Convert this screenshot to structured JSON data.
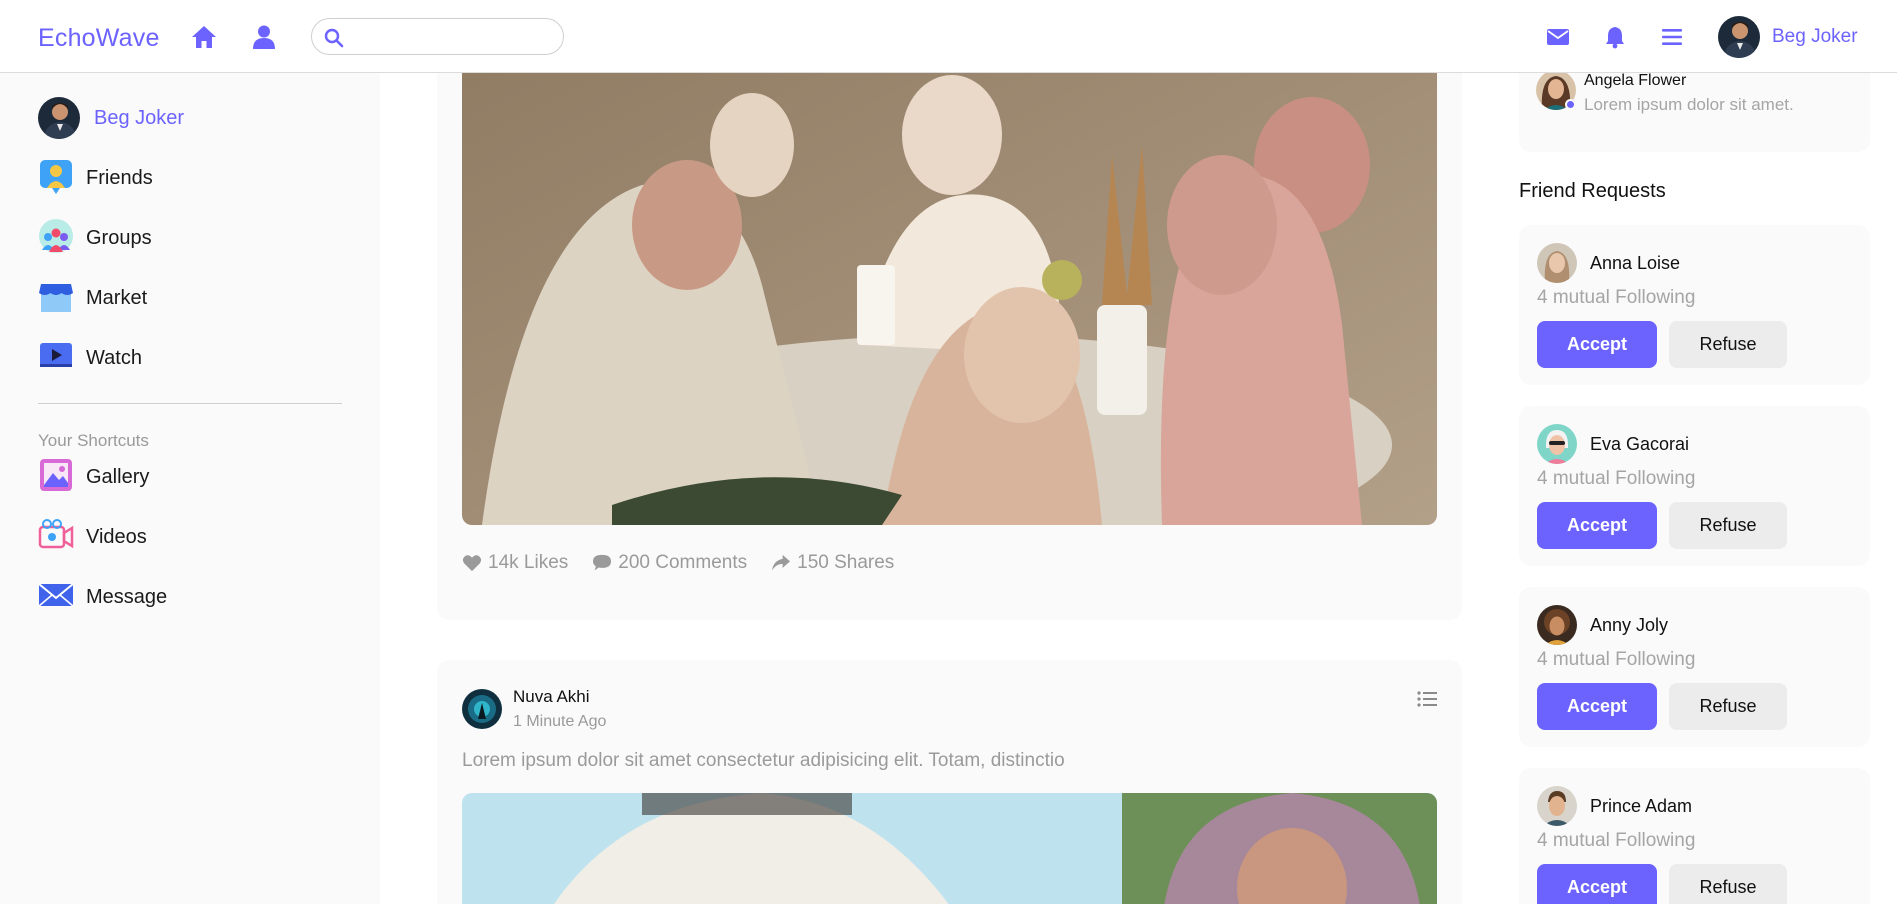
{
  "header": {
    "logo": "EchoWave",
    "search": {
      "value": "",
      "placeholder": ""
    },
    "user": {
      "name": "Beg Joker"
    },
    "accent": "#6c63ff"
  },
  "sidebar": {
    "profile": {
      "label": "Beg Joker"
    },
    "items": [
      {
        "label": "Friends",
        "icon": "friends-icon"
      },
      {
        "label": "Groups",
        "icon": "groups-icon"
      },
      {
        "label": "Market",
        "icon": "market-icon"
      },
      {
        "label": "Watch",
        "icon": "watch-icon"
      }
    ],
    "shortcuts_title": "Your Shortcuts",
    "shortcuts": [
      {
        "label": "Gallery",
        "icon": "gallery-icon"
      },
      {
        "label": "Videos",
        "icon": "videos-icon"
      },
      {
        "label": "Message",
        "icon": "message-icon"
      }
    ]
  },
  "feed": {
    "post1": {
      "stats": {
        "likes": "14k Likes",
        "comments": "200 Comments",
        "shares": "150 Shares"
      }
    },
    "post2": {
      "author": "Nuva Akhi",
      "time": "1 Minute Ago",
      "text": "Lorem ipsum dolor sit amet consectetur adipisicing elit. Totam, distinctio"
    }
  },
  "messages": [
    {
      "name": "Angela Flower",
      "text": "Lorem ipsum dolor sit amet.",
      "online": true
    }
  ],
  "friend_requests": {
    "title": "Friend Requests",
    "accept_label": "Accept",
    "refuse_label": "Refuse",
    "items": [
      {
        "name": "Anna Loise",
        "mutual": "4 mutual Following"
      },
      {
        "name": "Eva Gacorai",
        "mutual": "4 mutual Following"
      },
      {
        "name": "Anny Joly",
        "mutual": "4 mutual Following"
      },
      {
        "name": "Prince Adam",
        "mutual": "4 mutual Following"
      }
    ]
  }
}
